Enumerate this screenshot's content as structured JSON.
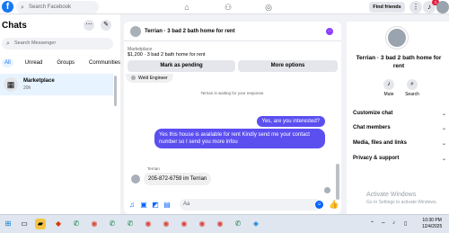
{
  "topbar": {
    "search_placeholder": "Search Facebook",
    "find_friends": "Find friends",
    "notif_count": "1"
  },
  "sidebar": {
    "title": "Chats",
    "search_placeholder": "Search Messenger",
    "filters": [
      "All",
      "Unread",
      "Groups",
      "Communities"
    ],
    "item": {
      "name": "Marketplace",
      "time": "20h"
    }
  },
  "chat": {
    "title": "Terrian · 3 bad 2 bath home for rent",
    "marketplace_label": "Marketplace",
    "listing": "$1,200 · 3 bad 2 bath home for rent",
    "mark_pending": "Mark as pending",
    "more_options": "More options",
    "msg_weld": "Weld Engineer",
    "waiting": "Terrian is waiting for your response.",
    "out1": "Yes, are you interested?",
    "out2": "Yes this house is available for rent Kindly send me your contact number so I send you more infou",
    "sender": "Terrian",
    "in_msg": "205-872-6759 im Terrian",
    "composer_placeholder": "Aa"
  },
  "right": {
    "title": "Terrian · 3 bad 2 bath home for rent",
    "mute": "Mute",
    "search": "Search",
    "rows": [
      "Customize chat",
      "Chat members",
      "Media, files and links",
      "Privacy & support"
    ]
  },
  "watermark": {
    "line1": "Activate Windows",
    "line2": "Go to Settings to activate Windows."
  },
  "taskbar": {
    "time": "10:30 PM",
    "date": "12/4/2025"
  }
}
